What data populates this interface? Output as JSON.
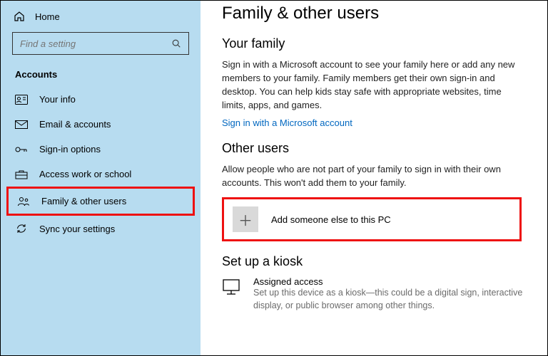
{
  "sidebar": {
    "home": "Home",
    "search_placeholder": "Find a setting",
    "section": "Accounts",
    "items": [
      {
        "label": "Your info"
      },
      {
        "label": "Email & accounts"
      },
      {
        "label": "Sign-in options"
      },
      {
        "label": "Access work or school"
      },
      {
        "label": "Family & other users"
      },
      {
        "label": "Sync your settings"
      }
    ]
  },
  "main": {
    "title": "Family & other users",
    "family_heading": "Your family",
    "family_text": "Sign in with a Microsoft account to see your family here or add any new members to your family. Family members get their own sign-in and desktop. You can help kids stay safe with appropriate websites, time limits, apps, and games.",
    "signin_link": "Sign in with a Microsoft account",
    "other_heading": "Other users",
    "other_text": "Allow people who are not part of your family to sign in with their own accounts. This won't add them to your family.",
    "add_label": "Add someone else to this PC",
    "kiosk_heading": "Set up a kiosk",
    "kiosk_title": "Assigned access",
    "kiosk_sub": "Set up this device as a kiosk—this could be a digital sign, interactive display, or public browser among other things."
  }
}
